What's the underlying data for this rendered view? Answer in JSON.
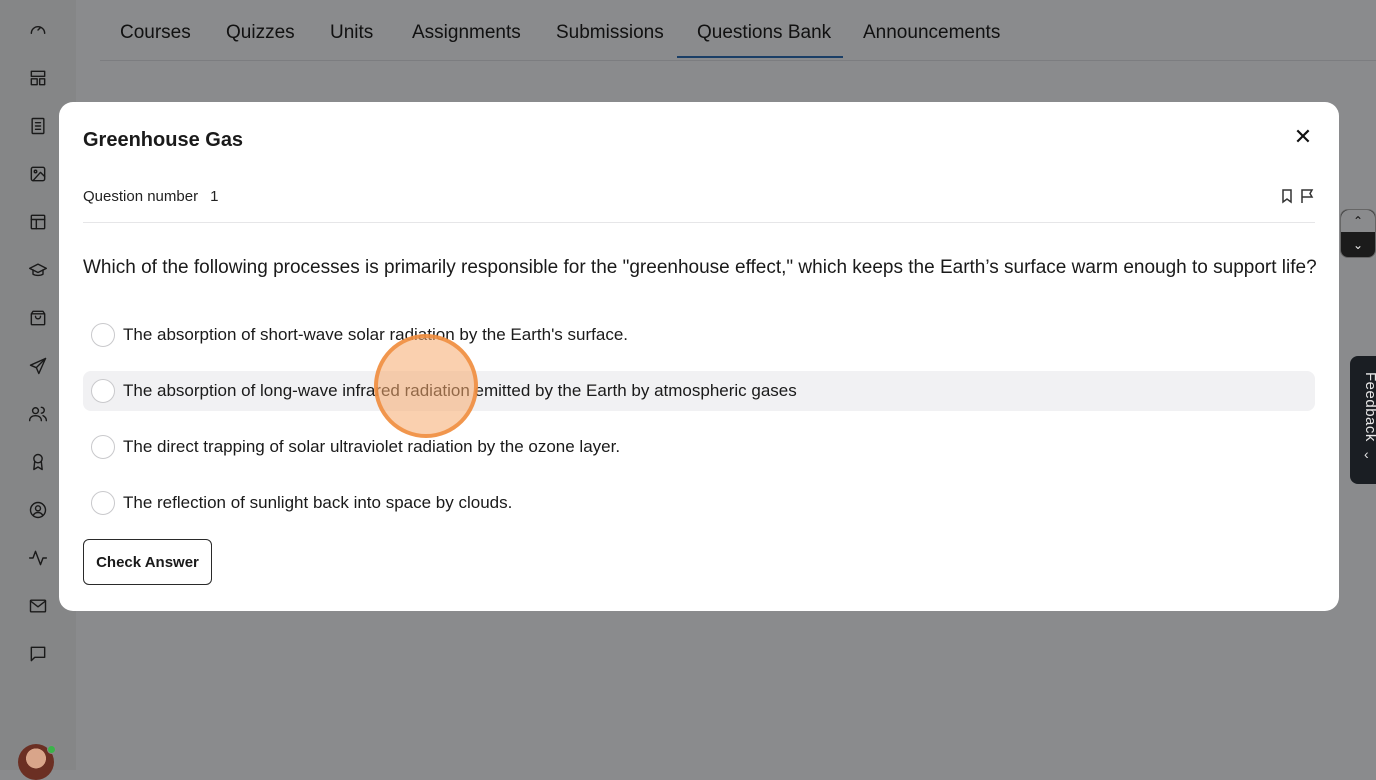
{
  "tabs": [
    {
      "label": "Courses"
    },
    {
      "label": "Quizzes"
    },
    {
      "label": "Units"
    },
    {
      "label": "Assignments"
    },
    {
      "label": "Submissions"
    },
    {
      "label": "Questions Bank"
    },
    {
      "label": "Announcements"
    }
  ],
  "active_tab": "Questions Bank",
  "sidebar": {
    "icons": [
      "dashboard-gauge-icon",
      "layout-icon",
      "book-icon",
      "image-icon",
      "table-icon",
      "graduation-cap-icon",
      "shopping-bag-icon",
      "send-icon",
      "users-icon",
      "award-icon",
      "user-circle-icon",
      "activity-icon",
      "mail-icon",
      "chat-icon"
    ]
  },
  "modal": {
    "title": "Greenhouse Gas",
    "close_label": "✕",
    "question_number_label": "Question number",
    "question_number": "1",
    "question_text": "Which of the following processes is primarily responsible for the \"greenhouse effect,\" which keeps the Earth’s surface warm enough to support life?",
    "options": [
      {
        "label": "The absorption of short-wave solar radiation by the Earth's surface."
      },
      {
        "label": "The absorption of long-wave infrared radiation emitted by the Earth by atmospheric gases"
      },
      {
        "label": "The direct trapping of solar ultraviolet radiation by the ozone layer."
      },
      {
        "label": "The reflection of sunlight back into space by clouds."
      }
    ],
    "check_button": "Check Answer"
  },
  "feedback_tab": "Feedback",
  "colors": {
    "overlay": "#8a8b8d",
    "accent_underline": "#1a3e66",
    "click_marker": "#f08c3c"
  }
}
